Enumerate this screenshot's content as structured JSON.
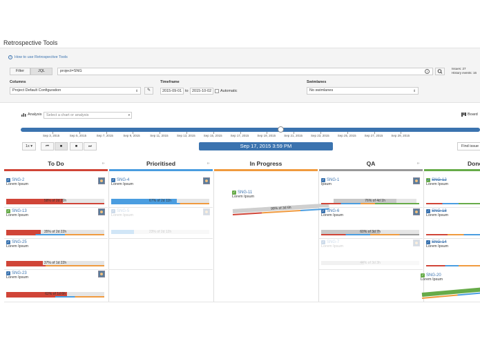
{
  "page_title": "Retrospective Tools",
  "help_link": "How to use Retrospective Tools",
  "filter_toggle": {
    "filter": "Filter",
    "jql": "JQL"
  },
  "jql_input": "project=SNG",
  "issues_info": {
    "issues": "Issues: 27",
    "history": "History events: 16"
  },
  "labels": {
    "columns": "Columns",
    "timeframe": "Timeframe",
    "swimlanes": "Swimlanes",
    "to": "to",
    "automatic": "Automatic"
  },
  "columns_select": "Project Default Configuration",
  "timeframe": {
    "from": "2015-09-01",
    "to": "2015-10-02"
  },
  "swimlanes_select": "No swimlanes",
  "analysis": {
    "label": "Analysis",
    "placeholder": "Select a chart or analysis"
  },
  "board_label": "Board",
  "timeline_progress": 0.565,
  "ticks": [
    "Sep 3, 2015",
    "Sep 5, 2015",
    "Sep 7, 2015",
    "Sep 9, 2015",
    "Sep 11, 2015",
    "Sep 13, 2015",
    "Sep 15, 2015",
    "Sep 17, 2015",
    "Sep 19, 2015",
    "Sep 21, 2015",
    "Sep 23, 2015",
    "Sep 25, 2015",
    "Sep 27, 2015",
    "Sep 29, 2015"
  ],
  "speed": "1x",
  "current_datetime": "Sep 17, 2015 3:59 PM",
  "find_issue": "Find issue",
  "board": {
    "columns": [
      {
        "name": "To Do",
        "color": "#d04437"
      },
      {
        "name": "Prioritised",
        "color": "#4a9de0"
      },
      {
        "name": "In Progress",
        "color": "#f09a3e"
      },
      {
        "name": "QA",
        "color": "#999999"
      },
      {
        "name": "Done",
        "color": "#67ab49"
      }
    ],
    "cards": {
      "sng2": {
        "id": "SNG-2",
        "subtitle": "Lorem Ipsum",
        "bar": "58% of 2d 20h"
      },
      "sng13": {
        "id": "SNG-13",
        "subtitle": "Lorem Ipsum",
        "bar": "35% of 2d 22h"
      },
      "sng25": {
        "id": "SNG-25",
        "subtitle": "Lorem Ipsum",
        "bar": "37% of 1d 22h"
      },
      "sng23": {
        "id": "SNG-23",
        "subtitle": "Lorem Ipsum",
        "bar": "62% of 1d 6h"
      },
      "sng4": {
        "id": "SNG-4",
        "subtitle": "Lorem Ipsum",
        "bar": "67% of 2d 11h"
      },
      "sng5": {
        "id": "SNG-5",
        "subtitle": "Lorem Ipsum",
        "bar": "23% of 2d 12h"
      },
      "sng11": {
        "id": "SNG-11",
        "subtitle": "Lorem Ipsum",
        "bar": "99% of 3d 6h"
      },
      "sng1": {
        "id": "SNG-1",
        "subtitle": "Ipsum",
        "bar": "76% of 4d 1h"
      },
      "sng6": {
        "id": "SNG-6",
        "subtitle": "Lorem Ipsum",
        "bar": "60% of 3d 7h"
      },
      "sng7": {
        "id": "SNG-7",
        "subtitle": "Lorem Ipsum",
        "bar": "44% of 3d 3h"
      },
      "sng12": {
        "id": "SNG-12",
        "subtitle": "Lorem Ipsum"
      },
      "sng18": {
        "id": "SNG-18",
        "subtitle": "Lorem Ipsum"
      },
      "sng14": {
        "id": "SNG-14",
        "subtitle": "Lorem Ipsum"
      },
      "sng20": {
        "id": "SNG-20",
        "subtitle": "Lorem Ipsum"
      }
    }
  }
}
